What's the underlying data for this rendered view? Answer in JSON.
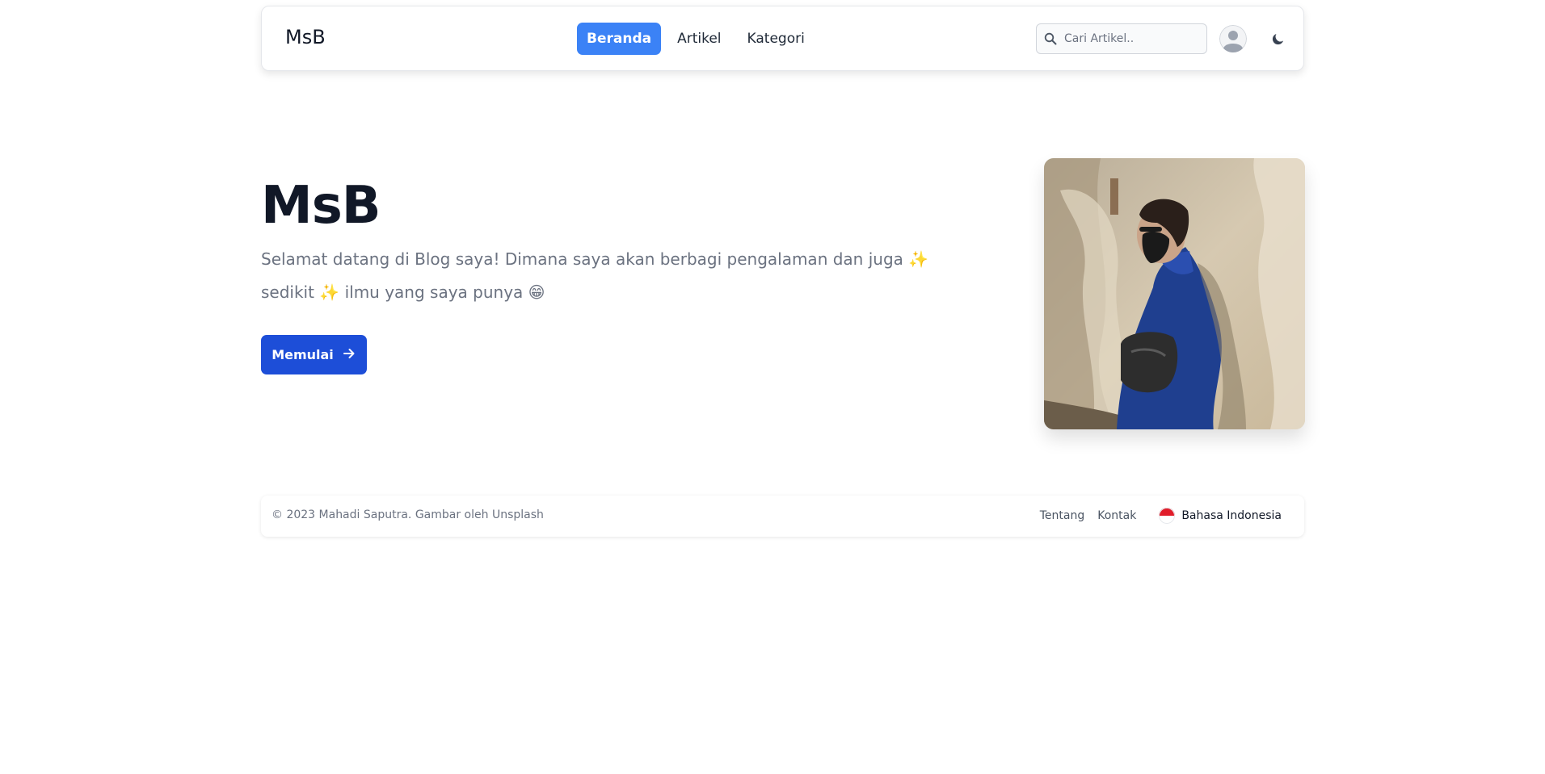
{
  "header": {
    "brand": "MsB",
    "nav": [
      {
        "label": "Beranda",
        "active": true
      },
      {
        "label": "Artikel",
        "active": false
      },
      {
        "label": "Kategori",
        "active": false
      }
    ],
    "search": {
      "placeholder": "Cari Artikel.."
    },
    "icons": {
      "search": "search-icon",
      "avatar": "avatar-icon",
      "theme": "moon-icon"
    }
  },
  "hero": {
    "title": "MsB",
    "description": "Selamat datang di Blog saya! Dimana saya akan berbagi pengalaman dan juga ✨ sedikit ✨ ilmu yang saya punya 😁",
    "cta_label": "Memulai",
    "cta_icon": "arrow-right-icon"
  },
  "footer": {
    "copyright": "© 2023 Mahadi Saputra. Gambar oleh Unsplash",
    "links": [
      "Tentang",
      "Kontak"
    ],
    "language": "Bahasa Indonesia",
    "language_icon": "indonesia-flag-icon"
  },
  "colors": {
    "accent": "#3b82f6",
    "cta": "#1d4ed8",
    "text_dark": "#111827",
    "text_muted": "#6b7280"
  }
}
